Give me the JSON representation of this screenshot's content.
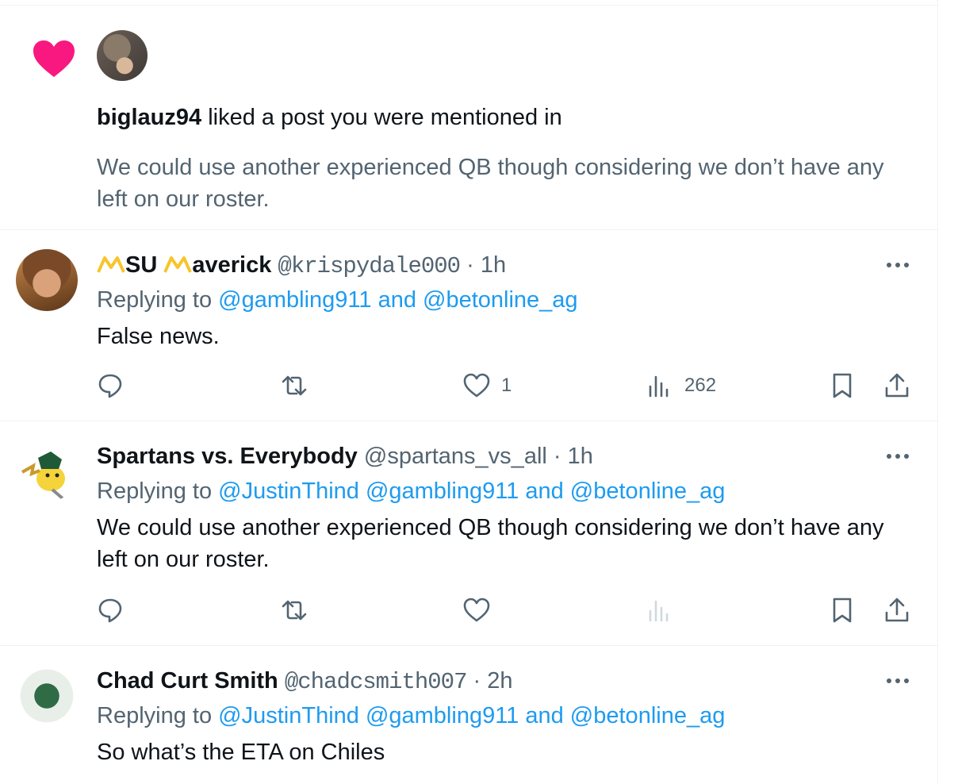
{
  "notification": {
    "user": "biglauz94",
    "action": " liked a post you were mentioned in",
    "text": "We could use another experienced QB though considering we don’t have any left on our roster."
  },
  "tweets": [
    {
      "name_part1": "SU",
      "name_part2": "averick",
      "handle": "@krispydale000",
      "dot": " · ",
      "time": "1h",
      "replying_prefix": "Replying to ",
      "replying_to": "@gambling911 and @betonline_ag",
      "text": "False news.",
      "likes": "1",
      "views": "262"
    },
    {
      "name": "Spartans vs. Everybody",
      "handle": "@spartans_vs_all",
      "dot": " · ",
      "time": "1h",
      "replying_prefix": "Replying to ",
      "replying_to": "@JustinThind @gambling911 and @betonline_ag",
      "text": "We could use another experienced QB though considering we don’t have any left on our roster."
    },
    {
      "name": "Chad Curt Smith",
      "handle": "@chadcsmith007",
      "dot": " · ",
      "time": "2h",
      "replying_prefix": "Replying to ",
      "replying_to": "@JustinThind @gambling911 and @betonline_ag",
      "text": "So what’s the ETA on Chiles"
    }
  ],
  "colors": {
    "like": "#f91880",
    "link": "#1d9bf0",
    "muted": "#536471",
    "logo": "#f7c52b"
  }
}
